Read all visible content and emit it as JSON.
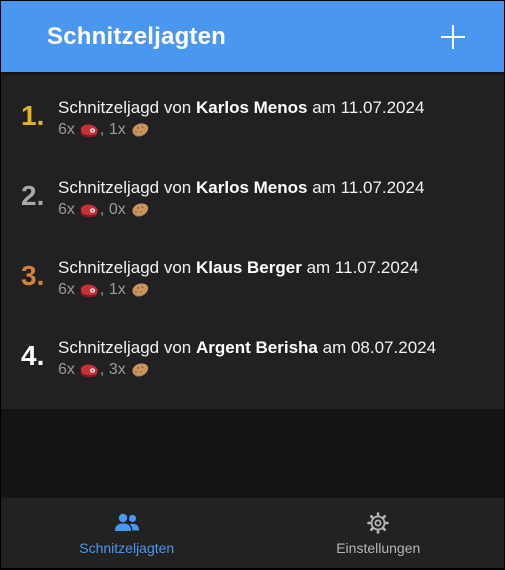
{
  "header": {
    "title": "Schnitzeljagten",
    "add_icon": "plus-icon"
  },
  "entries": [
    {
      "rank": "1.",
      "rank_color": "#e3b31f",
      "prefix": "Schnitzeljagd von",
      "name": "Karlos Menos",
      "date_prefix": "am",
      "date": "11.07.2024",
      "meat_count": "6x",
      "potato_count": "1x"
    },
    {
      "rank": "2.",
      "rank_color": "#a8a8a8",
      "prefix": "Schnitzeljagd von",
      "name": "Karlos Menos",
      "date_prefix": "am",
      "date": "11.07.2024",
      "meat_count": "6x",
      "potato_count": "0x"
    },
    {
      "rank": "3.",
      "rank_color": "#d0843a",
      "prefix": "Schnitzeljagd von",
      "name": "Klaus Berger",
      "date_prefix": "am",
      "date": "11.07.2024",
      "meat_count": "6x",
      "potato_count": "1x"
    },
    {
      "rank": "4.",
      "rank_color": "#ffffff",
      "prefix": "Schnitzeljagd von",
      "name": "Argent Berisha",
      "date_prefix": "am",
      "date": "08.07.2024",
      "meat_count": "6x",
      "potato_count": "3x"
    }
  ],
  "count_separator": ",",
  "icons": {
    "meat": "meat-emoji-icon",
    "potato": "potato-emoji-icon"
  },
  "nav": {
    "items": [
      {
        "label": "Schnitzeljagten",
        "icon": "people-icon",
        "active": true
      },
      {
        "label": "Einstellungen",
        "icon": "gear-icon",
        "active": false
      }
    ],
    "active_color": "#4a97f1",
    "inactive_color": "#b5b5b5"
  },
  "colors": {
    "header_bg": "#4a97f1",
    "list_bg": "#212121",
    "app_bg": "#141414",
    "nav_bg": "#222222"
  }
}
